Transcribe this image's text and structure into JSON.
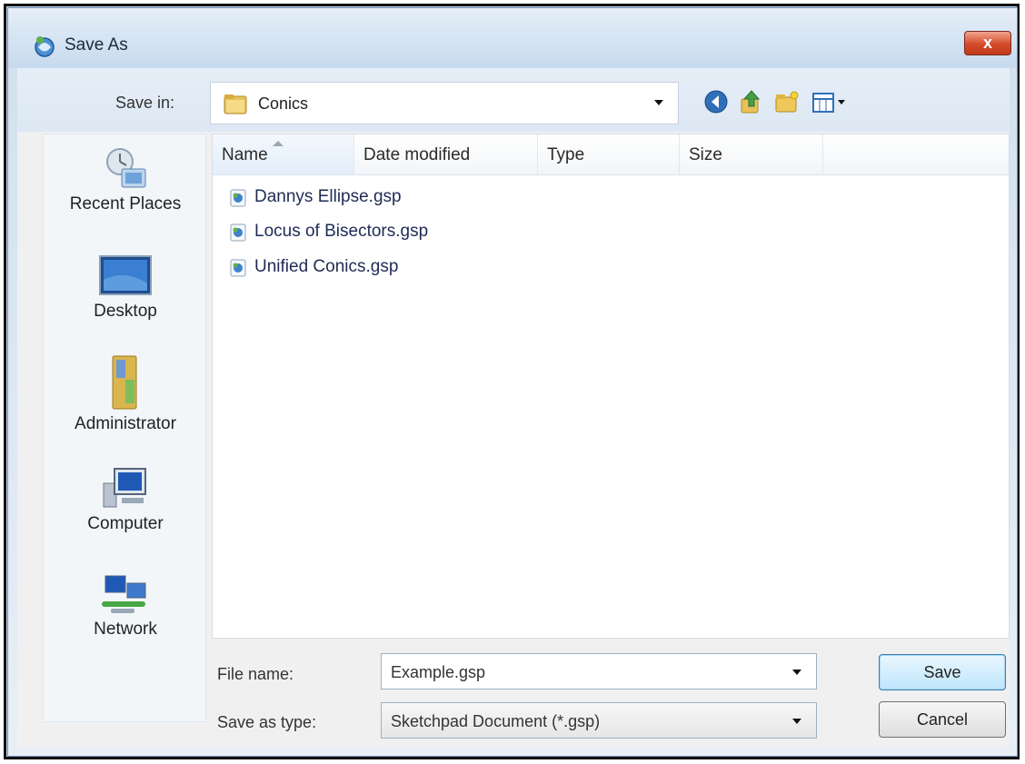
{
  "window": {
    "title": "Save As",
    "close_label": "x"
  },
  "toolbar": {
    "save_in_label": "Save in:",
    "current_folder": "Conics",
    "icons": [
      "back-icon",
      "up-folder-icon",
      "new-folder-icon",
      "views-menu-icon"
    ]
  },
  "places": {
    "items": [
      {
        "label": "Recent Places",
        "icon": "recent-places-icon"
      },
      {
        "label": "Desktop",
        "icon": "desktop-icon"
      },
      {
        "label": "Administrator",
        "icon": "user-folder-icon"
      },
      {
        "label": "Computer",
        "icon": "computer-icon"
      },
      {
        "label": "Network",
        "icon": "network-icon"
      }
    ]
  },
  "file_list": {
    "columns": [
      "Name",
      "Date modified",
      "Type",
      "Size"
    ],
    "files": [
      {
        "name": "Dannys Ellipse.gsp"
      },
      {
        "name": "Locus of Bisectors.gsp"
      },
      {
        "name": "Unified Conics.gsp"
      }
    ]
  },
  "form": {
    "file_name_label": "File name:",
    "file_name_value": "Example.gsp",
    "save_type_label": "Save as type:",
    "save_type_value": "Sketchpad Document (*.gsp)"
  },
  "buttons": {
    "save": "Save",
    "cancel": "Cancel"
  },
  "colors": {
    "accent": "#3c7fb1",
    "close": "#d44b2a",
    "file_text": "#1e2b55"
  }
}
